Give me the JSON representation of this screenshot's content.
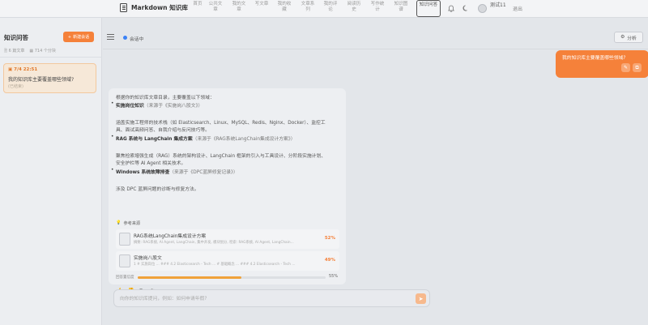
{
  "app": {
    "title": "Markdown 知识库"
  },
  "nav": {
    "links": [
      "首页",
      "公共文章",
      "我的文章",
      "写文章",
      "我的收藏",
      "文章系列",
      "我的评论",
      "阅读历史",
      "写作统计",
      "知识图谱",
      "知识问答"
    ],
    "active": "知识问答",
    "theme_icon": "moon-icon",
    "user": "测试11",
    "logout": "退出"
  },
  "sidebar": {
    "title": "知识问答",
    "new_button": "新建会话",
    "stats": {
      "docs": "6 篇文章",
      "chunks": "714 个分块"
    },
    "sessions": [
      {
        "time": "7/4 22:51",
        "title": "我的知识库主要覆盖哪些领域?",
        "sub": "(已结束)"
      }
    ]
  },
  "main": {
    "status": "会话中",
    "analyze": "分析"
  },
  "user_message": "我的知识库主要覆盖哪些领域?",
  "answer": {
    "intro": "根据你的知识库文章目录，主要覆盖以下领域：",
    "items": [
      {
        "title": "实施岗位知识",
        "source": "（来源于《实施岗八股文》）",
        "desc": [
          "涵盖实施工程师的技术栈（如 Elasticsearch、Linux、MySQL、Redis、Nginx、Docker）、监控工",
          "具、面试高频问答、自我介绍与反问技巧等。"
        ]
      },
      {
        "title": "RAG 系统与 LangChain 集成方案",
        "source": "（来源于《RAG系统LangChain集成设计方案》）",
        "desc": [
          "聚焦检索增强生成（RAG）系统的架构设计、LangChain 框架的引入与工具设计、分阶段实施计划、",
          "安全护栏等 AI Agent 相关技术。"
        ]
      },
      {
        "title": "Windows 系统故障排查",
        "source": "（来源于《DPC蓝屏修复记录》）",
        "desc": [
          "涉及 DPC 蓝屏问题的诊断与修复方法。"
        ]
      }
    ]
  },
  "references": {
    "header": "参考来源",
    "items": [
      {
        "title": "RAG系统LangChain集成设计方案",
        "snippet": "摘要: RAG系统, AI Agent, LangChain, 集中开发, 模块划分, 检索: RAG系统, AI Agent, LangChain...",
        "score": "52%"
      },
      {
        "title": "实施岗八股文",
        "snippet": "1 # 实施岗位 ... ### 4.2 Elasticsearch - Tech ... # 基础概念 ... ### 4.2 Elasticsearch - Tech ...",
        "score": "49%"
      }
    ]
  },
  "progress": {
    "label": "回答置信度",
    "value": 0.55,
    "display": "55%"
  },
  "input": {
    "placeholder": "向你的知识库提问，例如：如何申请年假?"
  },
  "colors": {
    "accent": "#f5813a",
    "progress": "#f0a23a",
    "status": "#3b82f6"
  }
}
